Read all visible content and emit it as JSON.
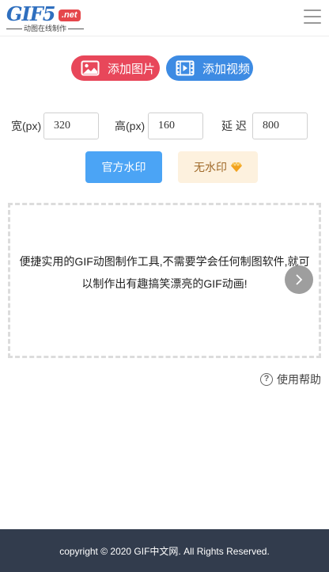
{
  "header": {
    "logo_text": "GIF5",
    "logo_domain": ".net",
    "logo_tagline": "动图在线制作",
    "menu_icon": "hamburger-menu-icon"
  },
  "actions": {
    "add_image_label": "添加图片",
    "add_image_icon": "image-icon",
    "add_image_color": "#e8475a",
    "add_video_label": "添加视频",
    "add_video_icon": "film-icon",
    "add_video_color": "#3d8be3"
  },
  "settings": {
    "width_label": "宽(px)",
    "width_value": "320",
    "height_label": "高(px)",
    "height_value": "160",
    "delay_label": "延 迟",
    "delay_value": "800"
  },
  "watermark": {
    "official_label": "官方水印",
    "official_color": "#4ba4f5",
    "none_label": "无水印",
    "none_icon": "gem-icon"
  },
  "drop_area": {
    "line1": "便捷实用的GIF动图制作工具,不需要学会任何制图软件,就可",
    "line2": "以制作出有趣搞笑漂亮的GIF动画!",
    "next_icon": "chevron-right-icon"
  },
  "help": {
    "label": "使用帮助",
    "icon": "question-circle-icon"
  },
  "footer": {
    "copyright": "copyright © 2020 GIF中文网. All Rights Reserved."
  }
}
